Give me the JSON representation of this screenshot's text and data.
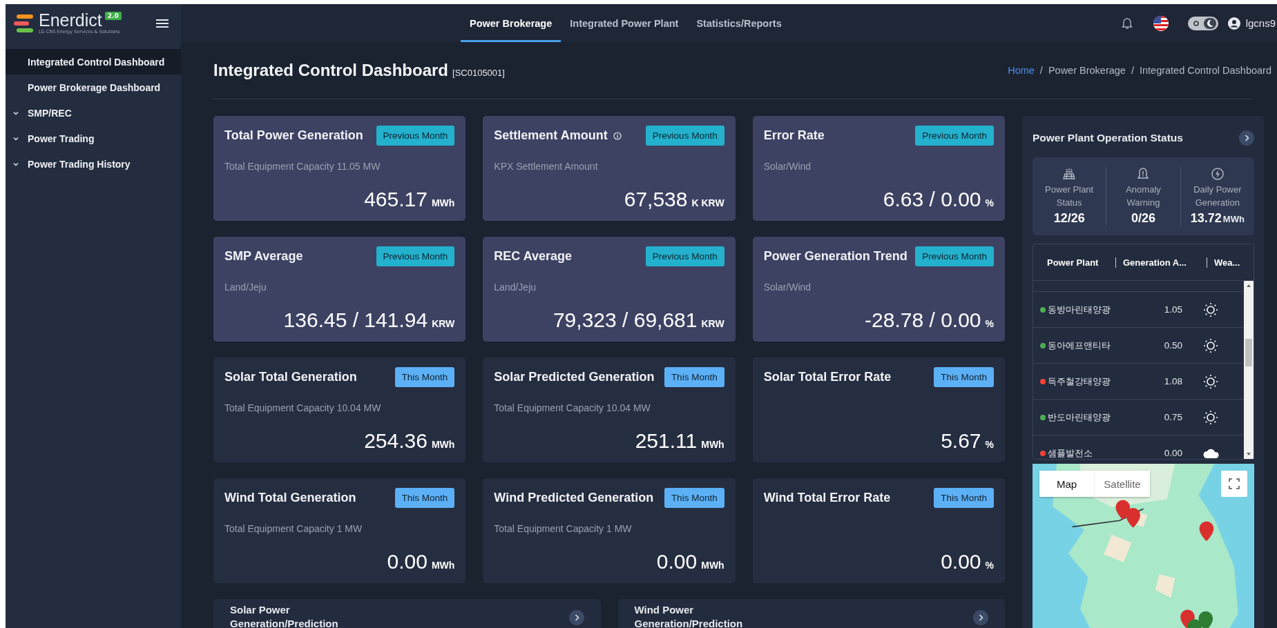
{
  "logo": {
    "name": "Enerdict",
    "version": "2.0",
    "tagline": "LG CNS Energy Services & Solutions"
  },
  "nav": [
    {
      "label": "Power Brokerage",
      "selected": true
    },
    {
      "label": "Integrated Power Plant",
      "selected": false
    },
    {
      "label": "Statistics/Reports",
      "selected": false
    }
  ],
  "dark_mode": true,
  "user": "lgcns9",
  "sidebar": [
    {
      "kind": "link",
      "label": "Integrated Control Dashboard",
      "selected": true
    },
    {
      "kind": "link",
      "label": "Power Brokerage Dashboard",
      "selected": false
    },
    {
      "kind": "group",
      "label": "SMP/REC",
      "selected": false,
      "expanded": false
    },
    {
      "kind": "group",
      "label": "Power Trading",
      "selected": false,
      "expanded": false
    },
    {
      "kind": "group",
      "label": "Power Trading History",
      "selected": false,
      "expanded": false
    }
  ],
  "page": {
    "title": "Integrated Control Dashboard",
    "code": "[SC0105001]"
  },
  "breadcrumb": {
    "separator": "/",
    "items": [
      "Home",
      "Power Brokerage",
      "Integrated Control Dashboard"
    ]
  },
  "cards": [
    {
      "title": "Total Power Generation",
      "info": false,
      "badge": {
        "label": "Previous Month",
        "kind": "previous"
      },
      "subtitle": "Total Equipment Capacity 11.05 MW",
      "value": "465.17",
      "unit": "MWh"
    },
    {
      "title": "Settlement Amount",
      "info": true,
      "badge": {
        "label": "Previous Month",
        "kind": "previous"
      },
      "subtitle": "KPX Settlement Amount",
      "value": "67,538",
      "unit": "K KRW"
    },
    {
      "title": "Error Rate",
      "info": false,
      "badge": {
        "label": "Previous Month",
        "kind": "previous"
      },
      "subtitle": "Solar/Wind",
      "value": "6.63 / 0.00",
      "unit": "%"
    },
    {
      "title": "SMP Average",
      "info": false,
      "badge": {
        "label": "Previous Month",
        "kind": "previous"
      },
      "subtitle": "Land/Jeju",
      "value": "136.45 / 141.94",
      "unit": "KRW"
    },
    {
      "title": "REC Average",
      "info": false,
      "badge": {
        "label": "Previous Month",
        "kind": "previous"
      },
      "subtitle": "Land/Jeju",
      "value": "79,323 / 69,681",
      "unit": "KRW"
    },
    {
      "title": "Power Generation Trend",
      "info": false,
      "badge": {
        "label": "Previous Month",
        "kind": "previous"
      },
      "subtitle": "Solar/Wind",
      "value": "-28.78 / 0.00",
      "unit": "%"
    },
    {
      "title": "Solar Total Generation",
      "info": false,
      "badge": {
        "label": "This Month",
        "kind": "current"
      },
      "subtitle": "Total Equipment Capacity 10.04 MW",
      "value": "254.36",
      "unit": "MWh"
    },
    {
      "title": "Solar Predicted Generation",
      "info": false,
      "badge": {
        "label": "This Month",
        "kind": "current"
      },
      "subtitle": "Total Equipment Capacity 10.04 MW",
      "value": "251.11",
      "unit": "MWh"
    },
    {
      "title": "Solar Total Error Rate",
      "info": false,
      "badge": {
        "label": "This Month",
        "kind": "current"
      },
      "value": "5.67",
      "unit": "%"
    },
    {
      "title": "Wind Total Generation",
      "info": false,
      "badge": {
        "label": "This Month",
        "kind": "current"
      },
      "subtitle": "Total Equipment Capacity 1 MW",
      "value": "0.00",
      "unit": "MWh"
    },
    {
      "title": "Wind Predicted Generation",
      "info": false,
      "badge": {
        "label": "This Month",
        "kind": "current"
      },
      "subtitle": "Total Equipment Capacity 1 MW",
      "value": "0.00",
      "unit": "MWh"
    },
    {
      "title": "Wind Total Error Rate",
      "info": false,
      "badge": {
        "label": "This Month",
        "kind": "current"
      },
      "value": "0.00",
      "unit": "%"
    }
  ],
  "bottom_panels": [
    {
      "title": "Solar Power Generation/Prediction"
    },
    {
      "title": "Wind Power Generation/Prediction"
    }
  ],
  "panel": {
    "title": "Power Plant Operation Status",
    "summary": [
      {
        "kind": "solar_panel",
        "label": "Power Plant Status",
        "value": "12/26"
      },
      {
        "kind": "alert",
        "label": "Anomaly Warning",
        "value": "0/26"
      },
      {
        "kind": "bolt",
        "label": "Daily Power Generation",
        "value": "13.72",
        "unit": "MWh"
      }
    ],
    "table": {
      "columns": [
        "Power Plant",
        "Generation A...",
        "Wea..."
      ],
      "rows": [
        {
          "name": "동방마린태양광",
          "color": "#4caf50",
          "value": "1.05",
          "kind": "sun"
        },
        {
          "name": "동아에프앤티타",
          "color": "#4caf50",
          "value": "0.50",
          "kind": "sun"
        },
        {
          "name": "득주철강태양광",
          "color": "#f44336",
          "value": "1.08",
          "kind": "sun"
        },
        {
          "name": "반도마린태양광",
          "color": "#4caf50",
          "value": "0.75",
          "kind": "sun"
        },
        {
          "name": "샘플발전소",
          "color": "#f44336",
          "value": "0.00",
          "kind": "cloud"
        }
      ]
    },
    "map": {
      "tabs": [
        {
          "label": "Map",
          "selected": true
        },
        {
          "label": "Satellite",
          "selected": false
        }
      ]
    }
  }
}
